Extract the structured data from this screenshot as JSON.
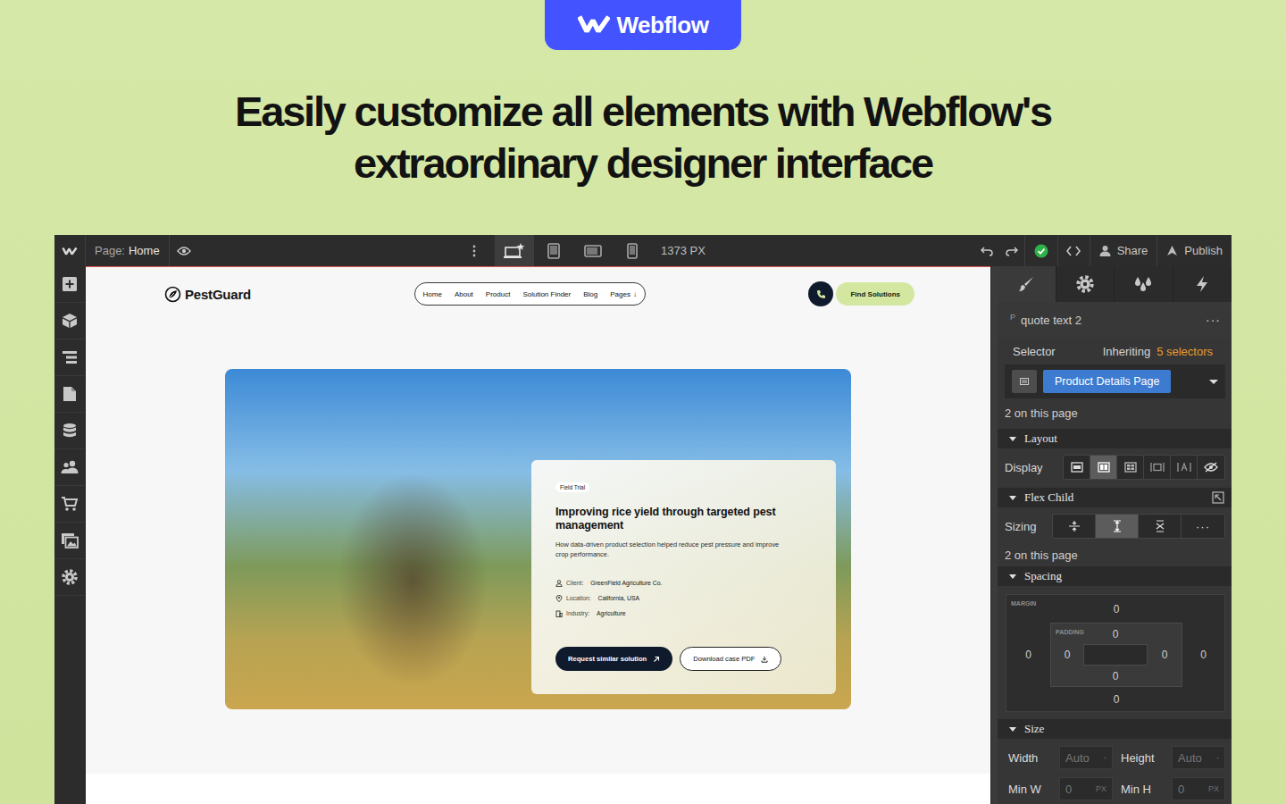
{
  "badge": {
    "label": "Webflow"
  },
  "headline": [
    "Easily customize all elements with Webflow's",
    "extraordinary designer interface"
  ],
  "topbar": {
    "page_label": "Page:",
    "page_name": "Home",
    "breakpoints": [
      {
        "selected": true
      },
      {
        "selected": false
      },
      {
        "selected": false
      },
      {
        "selected": false
      }
    ],
    "canvas_width": "1373 PX",
    "share": "Share",
    "publish": "Publish"
  },
  "site": {
    "logo": "PestGuard",
    "nav": [
      {
        "label": "Home"
      },
      {
        "label": "About"
      },
      {
        "label": "Product"
      },
      {
        "label": "Solution Finder"
      },
      {
        "label": "Blog"
      },
      {
        "label": "Pages",
        "suffix": "↓"
      }
    ],
    "cta": "Find Solutions"
  },
  "case_card": {
    "badge": "Field Trial",
    "title": "Improving rice yield through targeted pest management",
    "description": "How data-driven product selection helped reduce pest pressure and improve crop performance.",
    "meta": [
      {
        "label": "Client:",
        "value": "GreenField Agriculture Co."
      },
      {
        "label": "Location:",
        "value": "California, USA"
      },
      {
        "label": "Industry:",
        "value": "Agriculture"
      }
    ],
    "buttons": [
      {
        "label": "Request similar solution",
        "kind": "primary"
      },
      {
        "label": "Download case PDF",
        "kind": "secondary"
      }
    ]
  },
  "style_panel": {
    "tabs": [
      {
        "selected": true
      },
      {
        "selected": false
      },
      {
        "selected": false
      },
      {
        "selected": false
      }
    ],
    "element": {
      "tag": "P",
      "name": "quote text 2",
      "menu": "···"
    },
    "selector": {
      "label": "Selector",
      "inheriting": "Inheriting",
      "inherited_count": "5 selectors",
      "chip": "Product Details Page",
      "on_page": "2 on this page"
    },
    "layout": {
      "title": "Layout",
      "display_label": "Display",
      "display_options": [
        {
          "selected": false
        },
        {
          "selected": true
        },
        {
          "selected": false
        },
        {
          "selected": false
        },
        {
          "selected": false
        },
        {
          "selected": false
        }
      ]
    },
    "flex_child": {
      "title": "Flex Child",
      "sizing_label": "Sizing",
      "sizing_options": [
        {
          "selected": false
        },
        {
          "selected": true
        },
        {
          "selected": false
        }
      ],
      "more": "···",
      "on_page": "2 on this page"
    },
    "spacing": {
      "title": "Spacing",
      "margin_label": "MARGIN",
      "padding_label": "PADDING",
      "margin": {
        "top": "0",
        "right": "0",
        "bottom": "0",
        "left": "0"
      },
      "padding": {
        "top": "0",
        "right": "0",
        "bottom": "0",
        "left": "0"
      }
    },
    "size": {
      "title": "Size",
      "fields": [
        {
          "label": "Width",
          "value": "Auto",
          "unit": "-"
        },
        {
          "label": "Height",
          "value": "Auto",
          "unit": "-"
        },
        {
          "label": "Min W",
          "value": "0",
          "unit": "PX"
        },
        {
          "label": "Min H",
          "value": "0",
          "unit": "PX"
        }
      ]
    }
  }
}
